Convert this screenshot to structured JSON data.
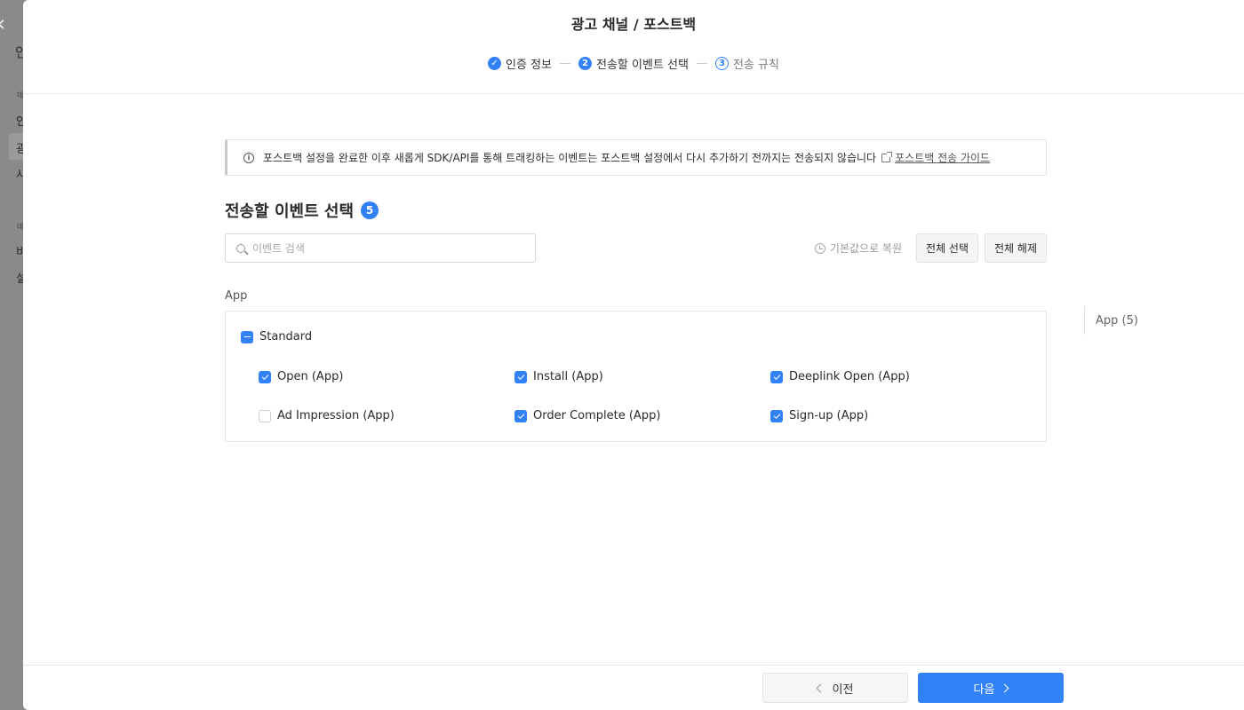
{
  "background": {
    "title_fragment": "인",
    "section_labels": [
      "데",
      "데"
    ],
    "items": [
      "인",
      "광",
      "사",
      "비",
      "설"
    ]
  },
  "drawer": {
    "title": "광고 채널 / 포스트백",
    "steps": [
      {
        "number": "1",
        "label": "인증 정보",
        "state": "done"
      },
      {
        "number": "2",
        "label": "전송할 이벤트 선택",
        "state": "current"
      },
      {
        "number": "3",
        "label": "전송 규칙",
        "state": "next"
      }
    ]
  },
  "notice": {
    "icon": "i",
    "text": "포스트백 설정을 완료한 이후 새롭게 SDK/API를 통해 트래킹하는 이벤트는 포스트백 설정에서 다시 추가하기 전까지는 전송되지 않습니다",
    "link_label": "포스트백 전송 가이드"
  },
  "section": {
    "title": "전송할 이벤트 선택",
    "count": "5"
  },
  "search": {
    "placeholder": "이벤트 검색",
    "value": ""
  },
  "toolbar": {
    "restore_label": "기본값으로 복원",
    "select_all_label": "전체 선택",
    "deselect_all_label": "전체 해제"
  },
  "group": {
    "label": "App",
    "category": {
      "label": "Standard",
      "state": "partial"
    },
    "events": [
      {
        "label": "Open (App)",
        "checked": true
      },
      {
        "label": "Install (App)",
        "checked": true
      },
      {
        "label": "Deeplink Open (App)",
        "checked": true
      },
      {
        "label": "Ad Impression (App)",
        "checked": false
      },
      {
        "label": "Order Complete (App)",
        "checked": true
      },
      {
        "label": "Sign-up (App)",
        "checked": true
      }
    ]
  },
  "side_nav": {
    "label": "App (5)"
  },
  "footer": {
    "prev_label": "이전",
    "next_label": "다음"
  },
  "colors": {
    "accent": "#3182f6",
    "backdrop": "#7d7d7d"
  }
}
